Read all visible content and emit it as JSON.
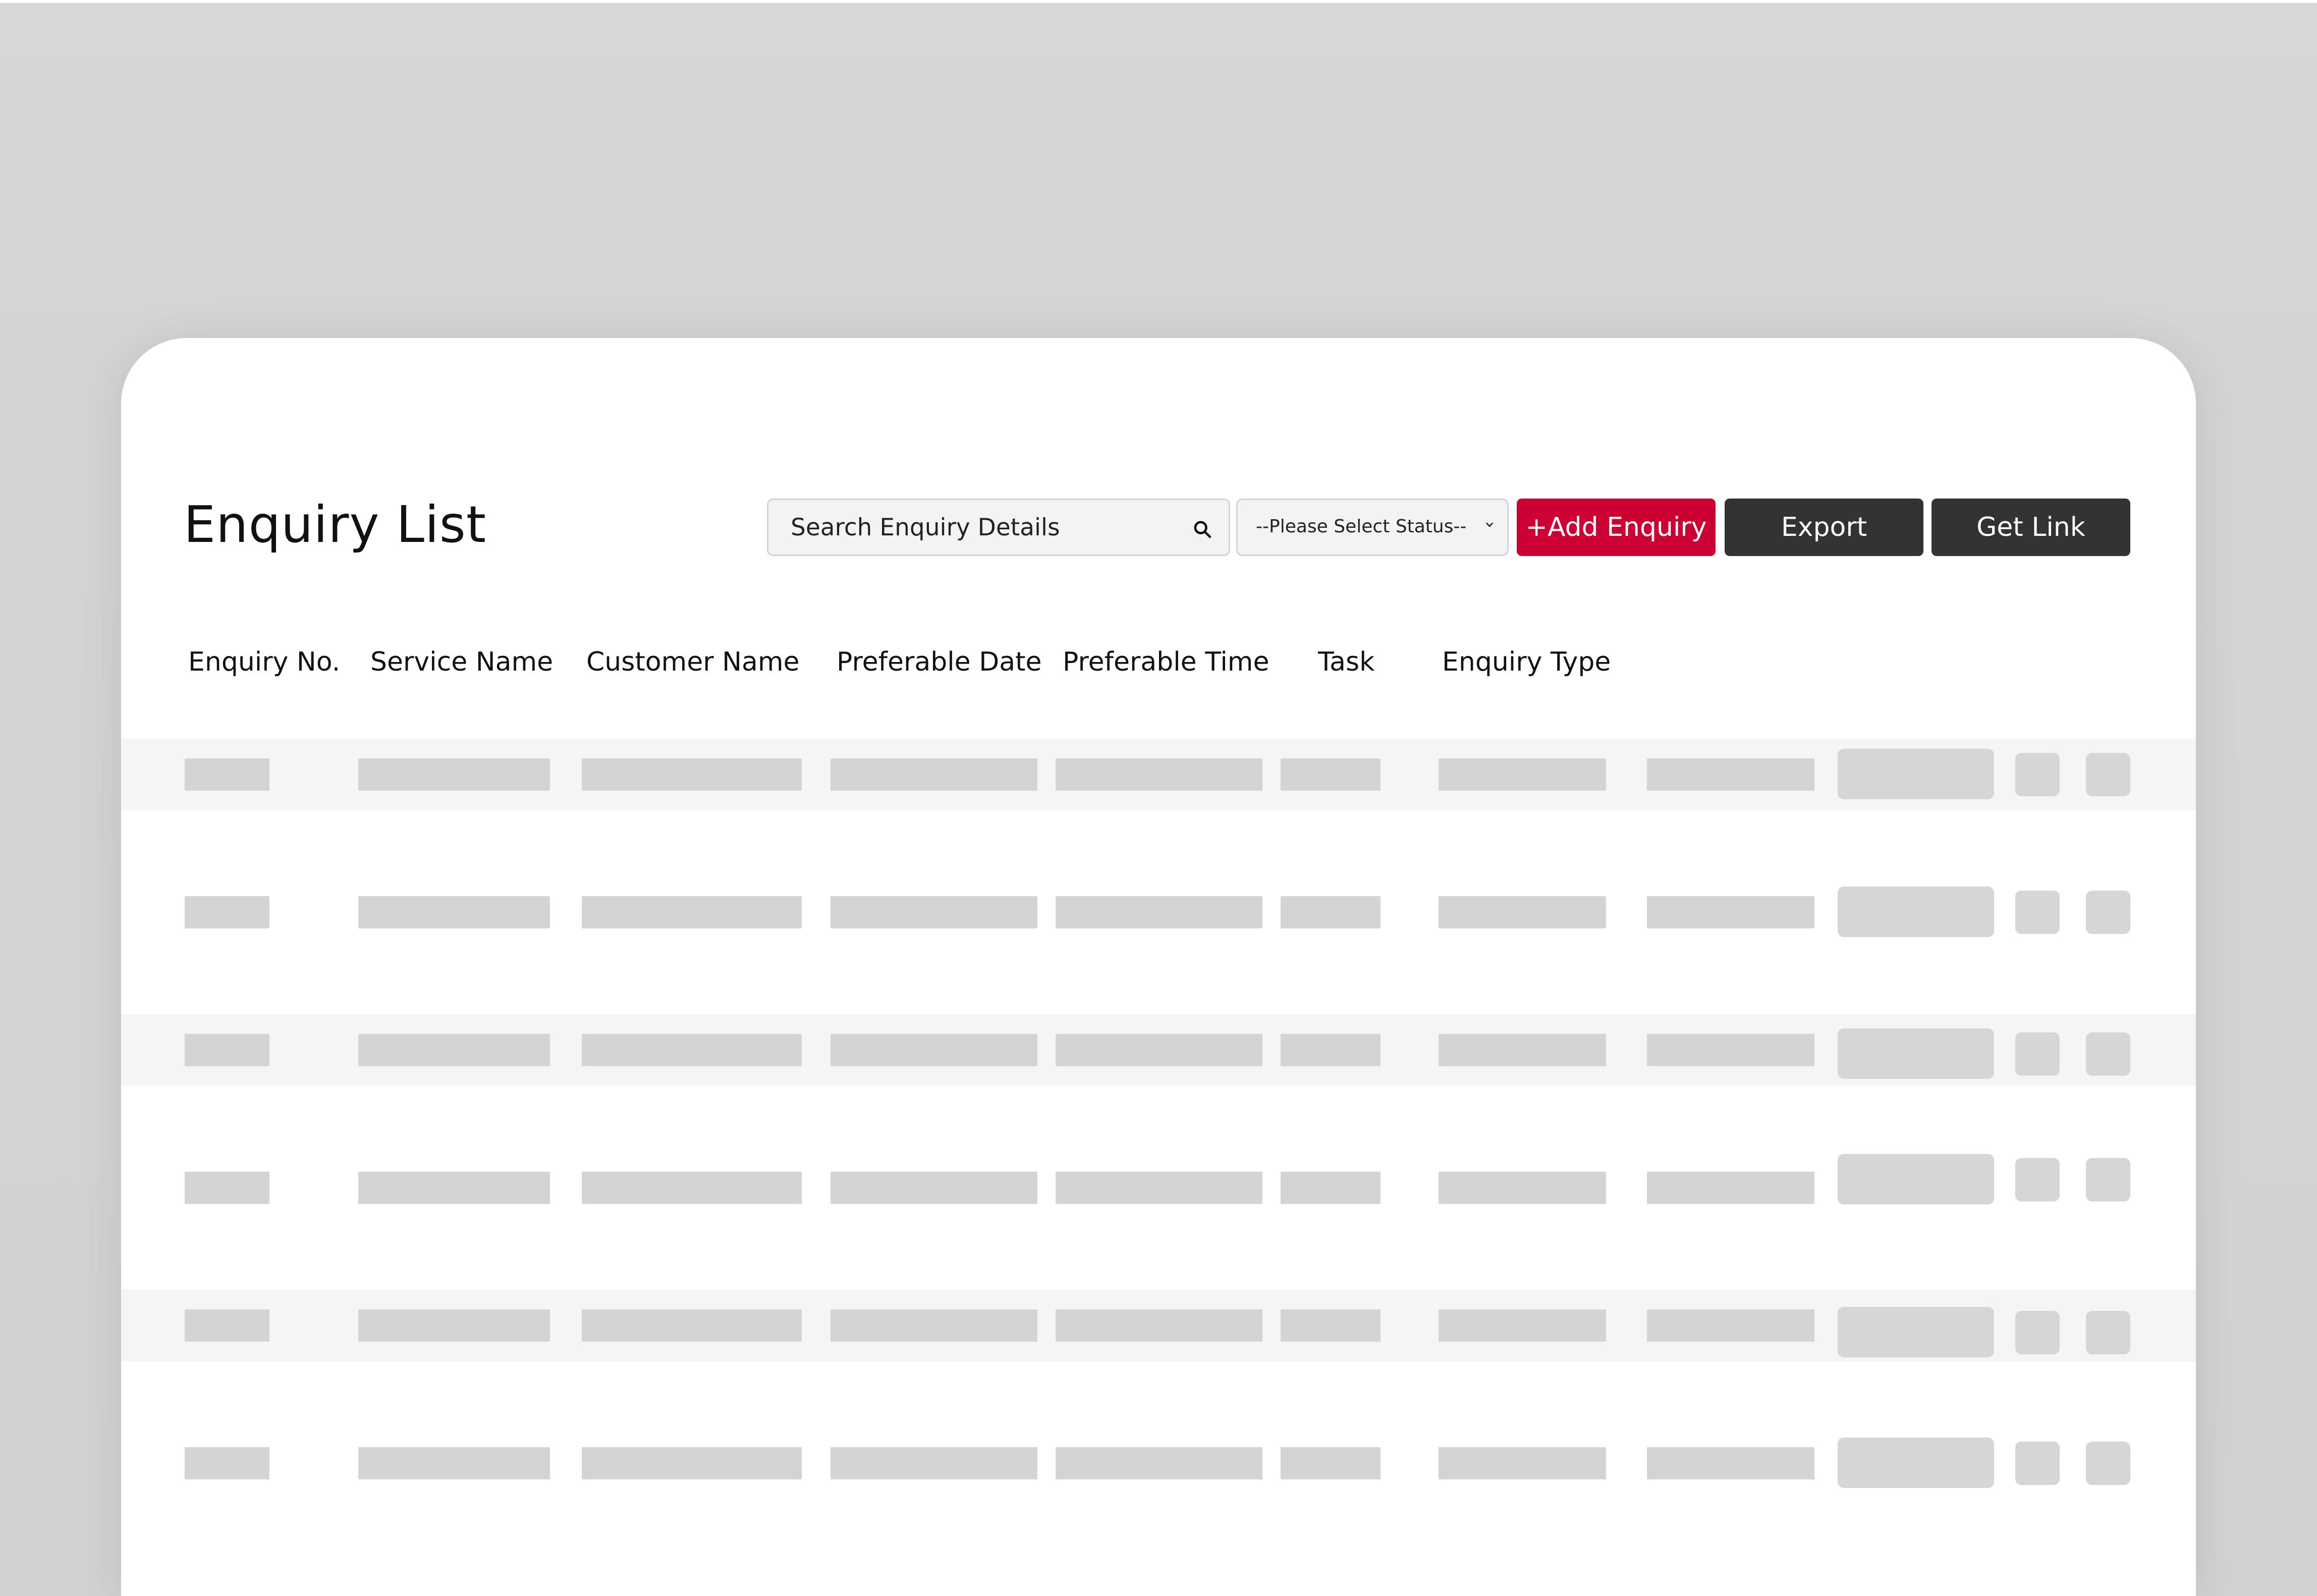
{
  "page": {
    "title": "Enquiry List"
  },
  "toolbar": {
    "search_placeholder": "Search Enquiry Details",
    "status_selected": "--Please Select Status--",
    "add_label": "+Add Enquiry",
    "export_label": "Export",
    "get_link_label": "Get Link"
  },
  "table": {
    "columns": [
      "Enquiry No.",
      "Service Name",
      "Customer Name",
      "Preferable Date",
      "Preferable Time",
      "Task",
      "Enquiry Type"
    ],
    "rows_state": "loading-skeleton"
  },
  "colors": {
    "accent": "#cc0033",
    "dark_button": "#333333",
    "background": "#d6d6d6",
    "skeleton": "#d4d4d6",
    "stripe": "#f5f5f6"
  }
}
